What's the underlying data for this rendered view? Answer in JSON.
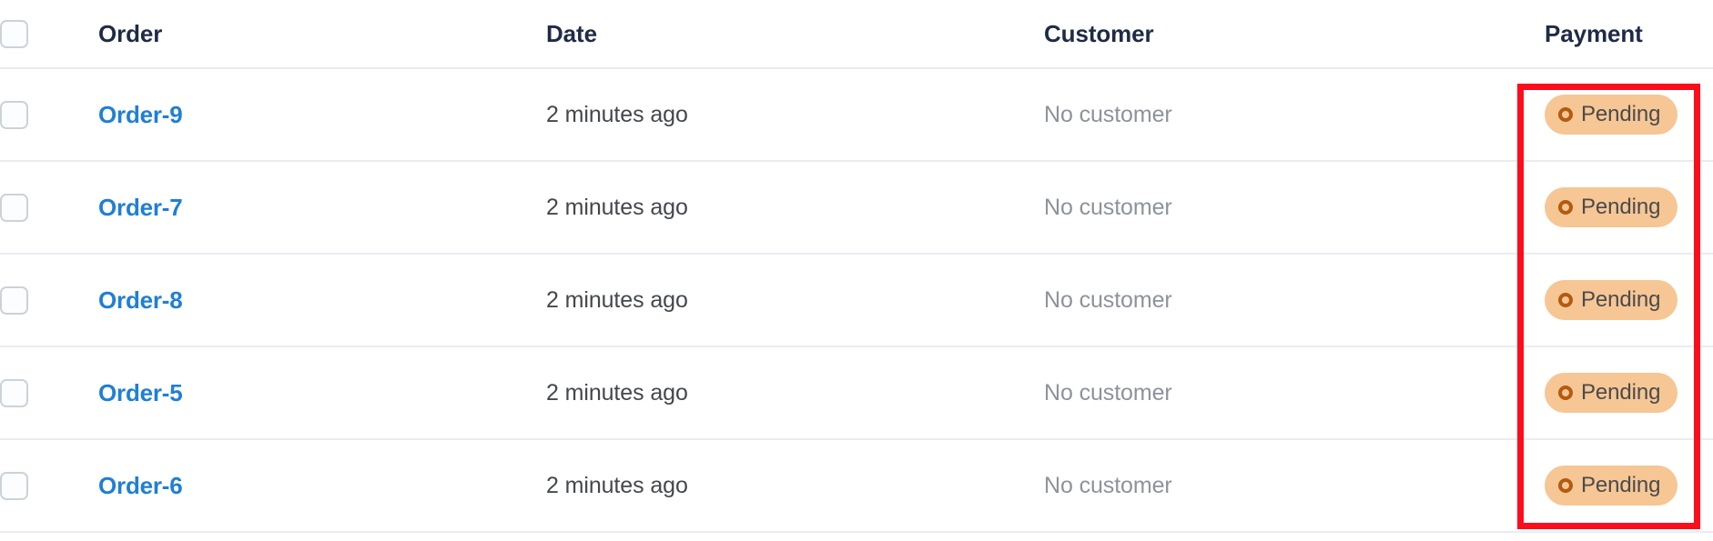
{
  "table": {
    "select_all_checkbox": "unchecked",
    "columns": [
      {
        "key": "select",
        "label": ""
      },
      {
        "key": "order",
        "label": "Order"
      },
      {
        "key": "date",
        "label": "Date"
      },
      {
        "key": "customer",
        "label": "Customer"
      },
      {
        "key": "payment",
        "label": "Payment"
      }
    ],
    "rows": [
      {
        "selected": false,
        "order": "Order-9",
        "date": "2 minutes ago",
        "customer": "No customer",
        "payment": "Pending"
      },
      {
        "selected": false,
        "order": "Order-7",
        "date": "2 minutes ago",
        "customer": "No customer",
        "payment": "Pending"
      },
      {
        "selected": false,
        "order": "Order-8",
        "date": "2 minutes ago",
        "customer": "No customer",
        "payment": "Pending"
      },
      {
        "selected": false,
        "order": "Order-5",
        "date": "2 minutes ago",
        "customer": "No customer",
        "payment": "Pending"
      },
      {
        "selected": false,
        "order": "Order-6",
        "date": "2 minutes ago",
        "customer": "No customer",
        "payment": "Pending"
      }
    ]
  },
  "icons": {
    "payment_status": "circle-ring-icon",
    "checkbox": "checkbox-icon"
  },
  "annotation": {
    "label": "payment-column-highlight",
    "color": "#fc0d1b"
  },
  "colors": {
    "link": "#1f7fd6",
    "badge_background": "#f6c695",
    "badge_ring": "#b35b10",
    "badge_text": "#4b4b4b",
    "muted_text": "#8d939b",
    "header_text": "#1f2b46",
    "row_border": "#eaecf2",
    "highlight": "#fc0d1b"
  }
}
